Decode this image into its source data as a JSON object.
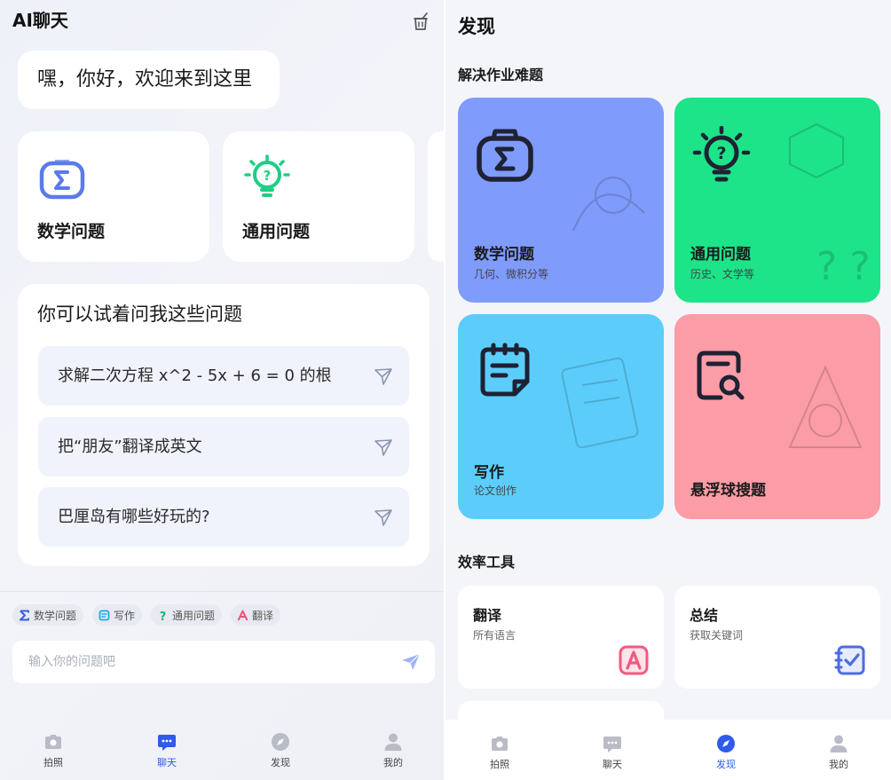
{
  "chat": {
    "title": "AI聊天",
    "greeting": "嘿，你好，欢迎来到这里",
    "cards": [
      {
        "label": "数学问题",
        "icon": "sigma-camera-icon"
      },
      {
        "label": "通用问题",
        "icon": "lightbulb-question-icon"
      }
    ],
    "suggest_title": "你可以试着问我这些问题",
    "suggestions": [
      "求解二次方程 x^2 - 5x + 6 = 0 的根",
      "把“朋友”翻译成英文",
      "巴厘岛有哪些好玩的?"
    ],
    "chips": [
      {
        "label": "数学问题",
        "icon": "sigma-icon"
      },
      {
        "label": "写作",
        "icon": "note-icon"
      },
      {
        "label": "通用问题",
        "icon": "question-icon"
      },
      {
        "label": "翻译",
        "icon": "letter-a-icon"
      }
    ],
    "input_placeholder": "输入你的问题吧",
    "tabs": [
      {
        "label": "拍照",
        "icon": "camera-icon"
      },
      {
        "label": "聊天",
        "icon": "chat-icon"
      },
      {
        "label": "发现",
        "icon": "compass-icon"
      },
      {
        "label": "我的",
        "icon": "person-icon"
      }
    ],
    "active_tab": "聊天"
  },
  "discover": {
    "title": "发现",
    "section1": "解决作业难题",
    "cards": [
      {
        "title": "数学问题",
        "subtitle": "几何、微积分等",
        "color": "#7f9bfb",
        "icon": "sigma-camera-icon"
      },
      {
        "title": "通用问题",
        "subtitle": "历史、文学等",
        "color": "#1de389",
        "icon": "lightbulb-question-icon"
      },
      {
        "title": "写作",
        "subtitle": "论文创作",
        "color": "#5ccdfb",
        "icon": "notepad-icon"
      },
      {
        "title": "悬浮球搜题",
        "subtitle": "",
        "color": "#fc9ca6",
        "icon": "search-document-icon"
      }
    ],
    "section2": "效率工具",
    "tools": [
      {
        "title": "翻译",
        "subtitle": "所有语言",
        "icon": "translate-icon",
        "color": "#f05a7e"
      },
      {
        "title": "总结",
        "subtitle": "获取关键词",
        "icon": "checklist-icon",
        "color": "#4a6de0"
      }
    ],
    "tabs": [
      {
        "label": "拍照",
        "icon": "camera-icon"
      },
      {
        "label": "聊天",
        "icon": "chat-icon"
      },
      {
        "label": "发现",
        "icon": "compass-icon"
      },
      {
        "label": "我的",
        "icon": "person-icon"
      }
    ],
    "active_tab": "发现"
  },
  "colors": {
    "accent": "#2f5bea",
    "inactive_icon": "#b9bcc6"
  }
}
